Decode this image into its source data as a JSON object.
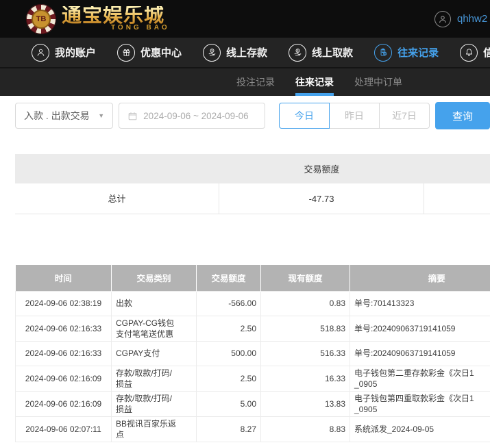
{
  "colors": {
    "accent_blue": "#45a2ec",
    "brand_gold": "#e0a83e",
    "table_header_gray": "#b3b3b3"
  },
  "header": {
    "logo": {
      "chip_text": "TB",
      "title": "通宝娱乐城",
      "subtitle": "TONG BAO"
    },
    "username": "qhhw2"
  },
  "nav": {
    "items": [
      {
        "label": "我的账户",
        "icon": "user-icon",
        "active": false
      },
      {
        "label": "优惠中心",
        "icon": "gift-icon",
        "active": false
      },
      {
        "label": "线上存款",
        "icon": "deposit-icon",
        "active": false
      },
      {
        "label": "线上取款",
        "icon": "withdraw-icon",
        "active": false
      },
      {
        "label": "往来记录",
        "icon": "records-icon",
        "active": true
      },
      {
        "label": "信息",
        "icon": "bell-icon",
        "active": false
      }
    ]
  },
  "tabs": [
    {
      "label": "投注记录",
      "active": false
    },
    {
      "label": "往来记录",
      "active": true
    },
    {
      "label": "处理中订单",
      "active": false
    }
  ],
  "filters": {
    "type_select_value": "入款 . 出款交易",
    "date_range": "2024-09-06 ~ 2024-09-06",
    "quick_buttons": [
      {
        "label": "今日",
        "active": true
      },
      {
        "label": "昨日",
        "active": false
      },
      {
        "label": "近7日",
        "active": false
      }
    ],
    "search_label": "查询"
  },
  "summary_table": {
    "header_label": "交易额度",
    "total_label": "总计",
    "total_value": "-47.73"
  },
  "transactions": {
    "columns": [
      "时间",
      "交易类别",
      "交易额度",
      "现有额度",
      "摘要"
    ],
    "rows": [
      {
        "time": "2024-09-06 02:38:19",
        "type": "出款",
        "amount": "-566.00",
        "balance": "0.83",
        "summary": "单号:701413323"
      },
      {
        "time": "2024-09-06 02:16:33",
        "type": "CGPAY-CG钱包\n支付笔笔送优惠",
        "amount": "2.50",
        "balance": "518.83",
        "summary": "单号:202409063719141059"
      },
      {
        "time": "2024-09-06 02:16:33",
        "type": "CGPAY支付",
        "amount": "500.00",
        "balance": "516.33",
        "summary": "单号:202409063719141059"
      },
      {
        "time": "2024-09-06 02:16:09",
        "type": "存款/取款/打码/\n损益",
        "amount": "2.50",
        "balance": "16.33",
        "summary": "电子钱包第二重存款彩金《次日1\n_0905"
      },
      {
        "time": "2024-09-06 02:16:09",
        "type": "存款/取款/打码/\n损益",
        "amount": "5.00",
        "balance": "13.83",
        "summary": "电子钱包第四重取款彩金《次日1\n_0905"
      },
      {
        "time": "2024-09-06 02:07:11",
        "type": "BB视讯百家乐返\n点",
        "amount": "8.27",
        "balance": "8.83",
        "summary": "系统派发_2024-09-05"
      }
    ]
  }
}
